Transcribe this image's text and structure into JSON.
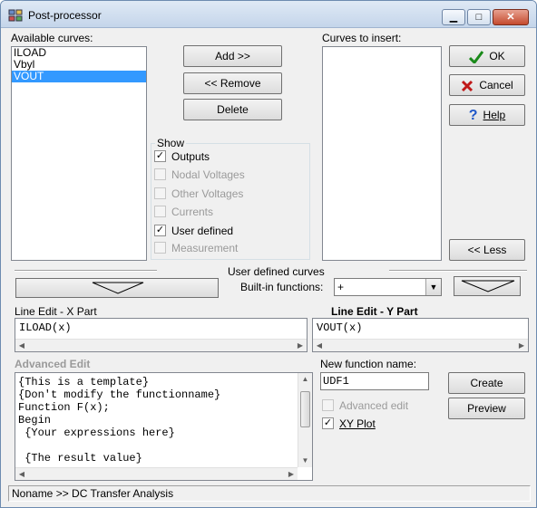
{
  "window": {
    "title": "Post-processor",
    "minimize_glyph": "▁",
    "maximize_glyph": "□",
    "close_glyph": "✕"
  },
  "available": {
    "label": "Available curves:",
    "items": [
      "ILOAD",
      "Vbyl",
      "VOUT"
    ],
    "selected_index": 2
  },
  "buttons": {
    "add": "Add >>",
    "remove": "<< Remove",
    "delete": "Delete",
    "ok": "OK",
    "cancel": "Cancel",
    "help": "Help",
    "less": "<< Less",
    "create": "Create",
    "preview": "Preview"
  },
  "show": {
    "title": "Show",
    "options": [
      {
        "label": "Outputs",
        "checked": true,
        "enabled": true
      },
      {
        "label": "Nodal Voltages",
        "checked": false,
        "enabled": false
      },
      {
        "label": "Other Voltages",
        "checked": false,
        "enabled": false
      },
      {
        "label": "Currents",
        "checked": false,
        "enabled": false
      },
      {
        "label": "User defined",
        "checked": true,
        "enabled": true
      },
      {
        "label": "Measurement",
        "checked": false,
        "enabled": false
      }
    ]
  },
  "insert": {
    "label": "Curves to insert:"
  },
  "user_defined": {
    "section_title": "User defined curves",
    "builtin_label": "Built-in functions:",
    "builtin_value": "+"
  },
  "line_edit": {
    "x_label": "Line Edit - X Part",
    "x_value": "ILOAD(x)",
    "y_label": "Line Edit - Y Part",
    "y_value": "VOUT(x)"
  },
  "advanced": {
    "title": "Advanced Edit",
    "lines": [
      "{This is a template}",
      "{Don't modify the functionname}",
      "Function F(x);",
      "Begin",
      " {Your expressions here}",
      "",
      " {The result value}"
    ]
  },
  "new_function": {
    "label": "New function name:",
    "value": "UDF1",
    "advanced_edit_label": "Advanced edit",
    "advanced_edit_checked": false,
    "xy_plot_label": "XY Plot",
    "xy_plot_checked": true
  },
  "status": {
    "text": "Noname >> DC Transfer Analysis"
  },
  "colors": {
    "selection": "#3399ff",
    "ok_check": "#1a8a1a",
    "cancel_x": "#c01818",
    "help_q": "#1f57c8"
  }
}
